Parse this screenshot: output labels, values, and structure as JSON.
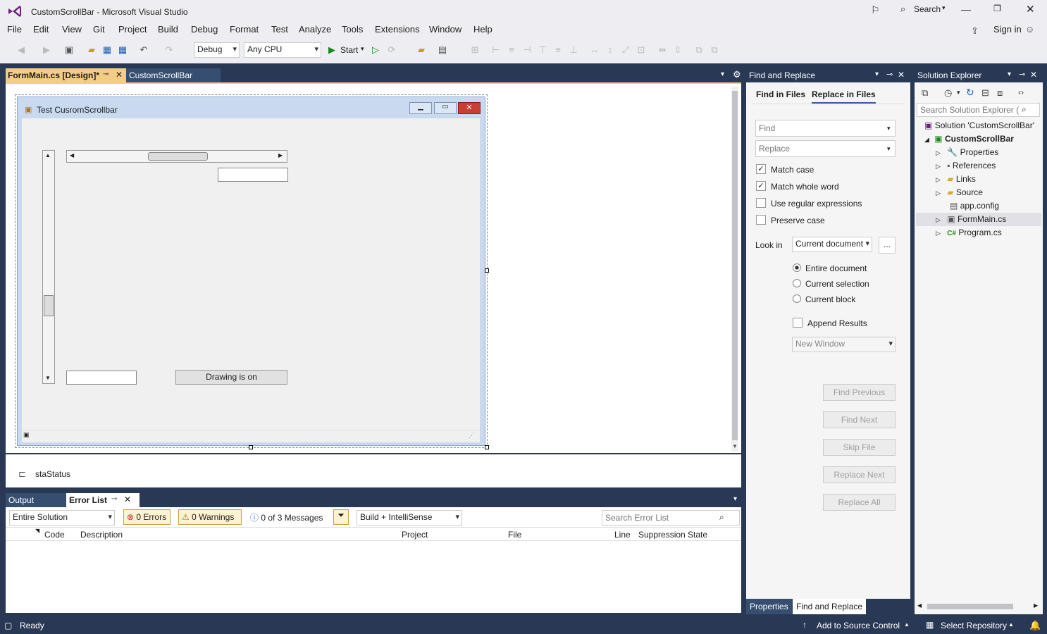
{
  "window": {
    "title": "CustomScrollBar - Microsoft Visual Studio",
    "search_label": "Search",
    "sign_in": "Sign in"
  },
  "menu": [
    "File",
    "Edit",
    "View",
    "Git",
    "Project",
    "Build",
    "Debug",
    "Format",
    "Test",
    "Analyze",
    "Tools",
    "Extensions",
    "Window",
    "Help"
  ],
  "toolbar": {
    "config": "Debug",
    "platform": "Any CPU",
    "start": "Start"
  },
  "doc_tabs": {
    "active": "FormMain.cs [Design]*",
    "inactive": "CustomScrollBar"
  },
  "form": {
    "title": "Test CusromScrollbar",
    "button_label": "Drawing is on"
  },
  "tray": {
    "component": "staStatus"
  },
  "bottom_panel": {
    "tabs": [
      "Output",
      "Error List"
    ],
    "scope": "Entire Solution",
    "errors": "0 Errors",
    "warnings": "0 Warnings",
    "messages": "0 of 3 Messages",
    "build_filter": "Build + IntelliSense",
    "search_placeholder": "Search Error List",
    "columns": [
      "Code",
      "Description",
      "Project",
      "File",
      "Line",
      "Suppression State"
    ]
  },
  "find_replace": {
    "title": "Find and Replace",
    "tabs": [
      "Find in Files",
      "Replace in Files"
    ],
    "find_placeholder": "Find",
    "replace_placeholder": "Replace",
    "match_case": "Match case",
    "match_whole_word": "Match whole word",
    "use_regex": "Use regular expressions",
    "preserve_case": "Preserve case",
    "look_in_label": "Look in",
    "look_in_value": "Current document",
    "browse": "...",
    "scope_options": [
      "Entire document",
      "Current selection",
      "Current block"
    ],
    "append_results": "Append Results",
    "window_option": "New Window",
    "buttons": [
      "Find Previous",
      "Find Next",
      "Skip File",
      "Replace Next",
      "Replace All"
    ],
    "bottom_tabs": [
      "Properties",
      "Find and Replace"
    ]
  },
  "solution_explorer": {
    "title": "Solution Explorer",
    "search_placeholder": "Search Solution Explorer (",
    "solution": "Solution 'CustomScrollBar'",
    "project": "CustomScrollBar",
    "items": [
      "Properties",
      "References",
      "Links",
      "Source",
      "app.config",
      "FormMain.cs",
      "Program.cs"
    ]
  },
  "status": {
    "ready": "Ready",
    "add_source_control": "Add to Source Control",
    "select_repository": "Select Repository"
  },
  "colors": {
    "chrome_bg": "#eeeef2",
    "panel_header": "#293955",
    "accent_tab": "#f5cc84",
    "vs_purple": "#68217a"
  }
}
